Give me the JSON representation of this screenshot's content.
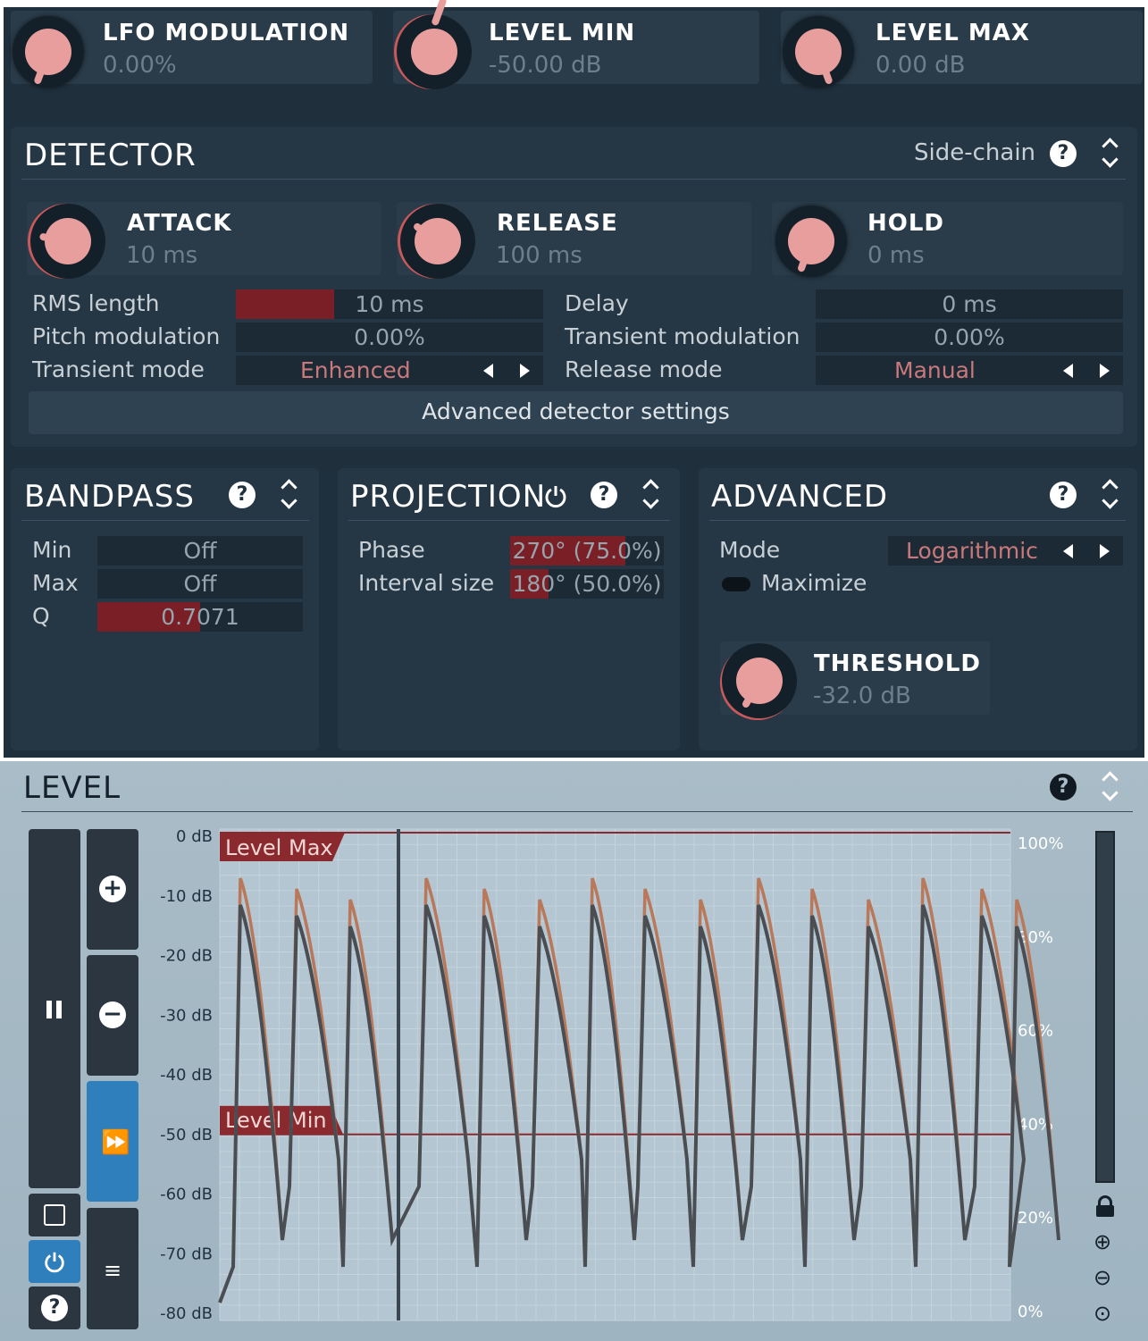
{
  "top": {
    "lfo": {
      "label": "LFO MODULATION",
      "value": "0.00%"
    },
    "level_min": {
      "label": "LEVEL MIN",
      "value": "-50.00 dB"
    },
    "level_max": {
      "label": "LEVEL MAX",
      "value": "0.00 dB"
    }
  },
  "detector": {
    "title": "DETECTOR",
    "sidechain": "Side-chain",
    "attack": {
      "label": "ATTACK",
      "value": "10 ms"
    },
    "release": {
      "label": "RELEASE",
      "value": "100 ms"
    },
    "hold": {
      "label": "HOLD",
      "value": "0 ms"
    },
    "params": {
      "rms_label": "RMS length",
      "rms_value": "10 ms",
      "rms_fill": 0.32,
      "delay_label": "Delay",
      "delay_value": "0 ms",
      "pitch_label": "Pitch modulation",
      "pitch_value": "0.00%",
      "transient_mod_label": "Transient modulation",
      "transient_mod_value": "0.00%",
      "transient_mode_label": "Transient mode",
      "transient_mode_value": "Enhanced",
      "release_mode_label": "Release mode",
      "release_mode_value": "Manual"
    },
    "advanced_button": "Advanced detector settings"
  },
  "bandpass": {
    "title": "BANDPASS",
    "min_label": "Min",
    "min_value": "Off",
    "max_label": "Max",
    "max_value": "Off",
    "q_label": "Q",
    "q_value": "0.7071",
    "q_fill": 0.5
  },
  "projection": {
    "title": "PROJECTION",
    "phase_label": "Phase",
    "phase_value": "270° (75.0%)",
    "phase_fill": 0.75,
    "interval_label": "Interval size",
    "interval_value": "180° (50.0%)",
    "interval_fill": 0.25
  },
  "advanced": {
    "title": "ADVANCED",
    "mode_label": "Mode",
    "mode_value": "Logarithmic",
    "maximize_label": "Maximize",
    "threshold": {
      "label": "THRESHOLD",
      "value": "-32.0 dB"
    }
  },
  "level": {
    "title": "LEVEL",
    "marker_max": "Level Max",
    "marker_min": "Level Min",
    "db_ticks": [
      "0 dB",
      "-10 dB",
      "-20 dB",
      "-30 dB",
      "-40 dB",
      "-50 dB",
      "-60 dB",
      "-70 dB",
      "-80 dB"
    ],
    "pct_ticks": [
      "100%",
      "80%",
      "60%",
      "40%",
      "20%",
      "0%"
    ]
  },
  "colors": {
    "accent": "#7a1f26",
    "knob": "#e79e9d",
    "panel": "#253745",
    "graph_bg": "#a9bcc7"
  }
}
